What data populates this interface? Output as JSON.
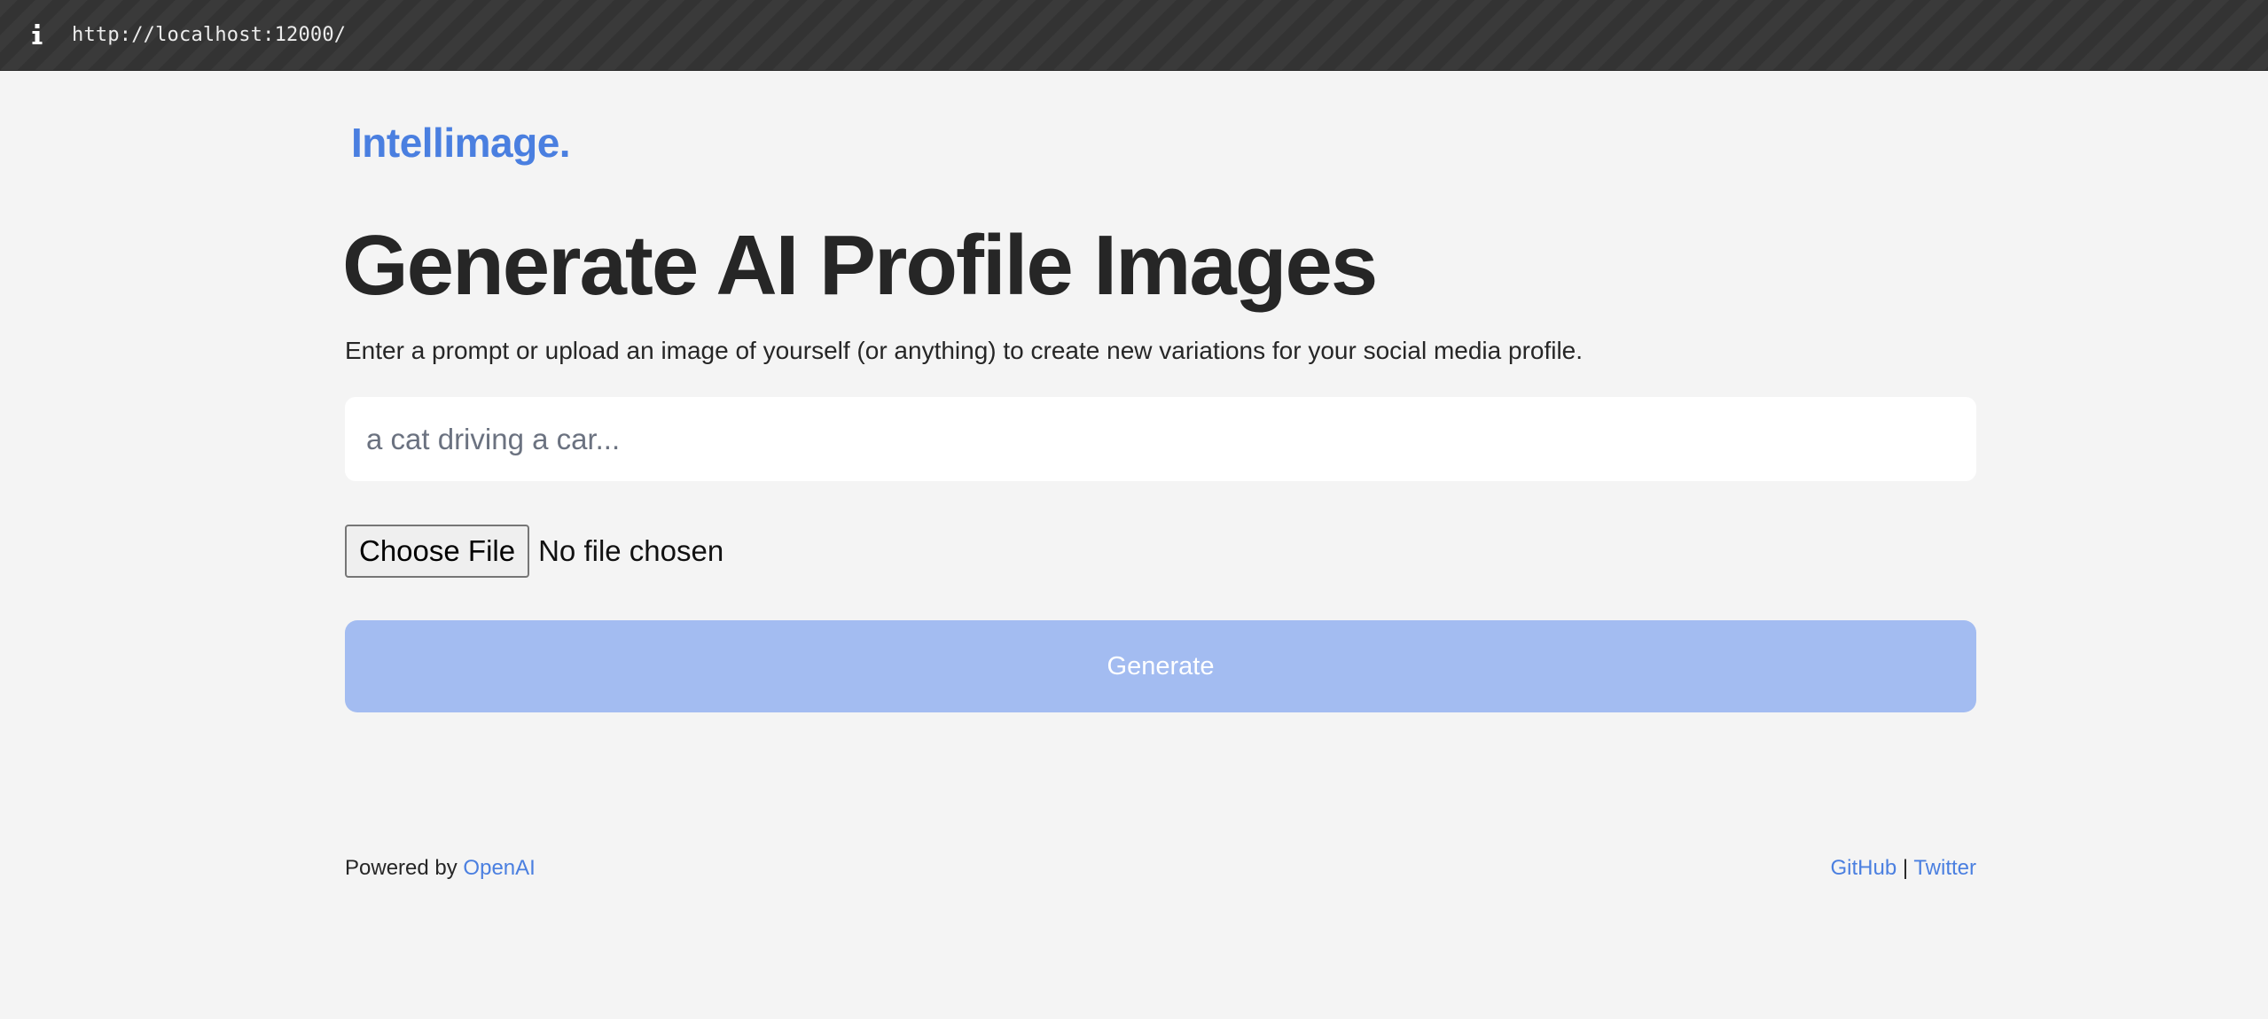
{
  "browser": {
    "url": "http://localhost:12000/",
    "info_icon": "info-icon"
  },
  "header": {
    "logo": "Intellimage."
  },
  "main": {
    "title": "Generate AI Profile Images",
    "subtitle": "Enter a prompt or upload an image of yourself (or anything) to create new variations for your social media profile.",
    "prompt": {
      "value": "",
      "placeholder": "a cat driving a car..."
    },
    "file_input": {
      "button_label": "Choose File",
      "status": "No file chosen"
    },
    "generate_label": "Generate"
  },
  "footer": {
    "powered_by": "Powered by",
    "openai_link": "OpenAI",
    "github_link": "GitHub",
    "separator": "|",
    "twitter_link": "Twitter"
  },
  "colors": {
    "accent": "#4a7fe0",
    "generate_disabled": "#a3bcf1",
    "background": "#f4f4f4",
    "text": "#262626",
    "browser_bar": "#333333"
  }
}
